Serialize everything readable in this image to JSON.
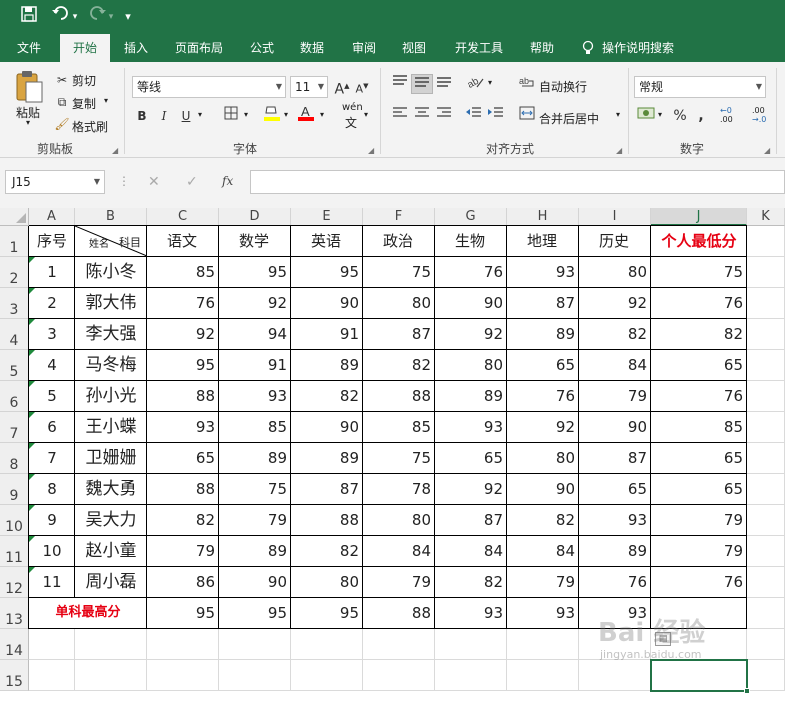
{
  "quick_access": {
    "save": "save-icon",
    "undo": "undo-icon",
    "redo": "redo-icon",
    "customize": "▾"
  },
  "menu": {
    "tabs": [
      "文件",
      "开始",
      "插入",
      "页面布局",
      "公式",
      "数据",
      "审阅",
      "视图",
      "开发工具",
      "帮助"
    ],
    "active": "开始",
    "tell_me": "操作说明搜索"
  },
  "ribbon": {
    "clipboard": {
      "paste": "粘贴",
      "cut": "剪切",
      "copy": "复制",
      "format_painter": "格式刷",
      "label": "剪贴板"
    },
    "font": {
      "name": "等线",
      "size": "11",
      "label": "字体",
      "grow": "A",
      "shrink": "A",
      "bold": "B",
      "italic": "I",
      "underline": "U",
      "wen": "wén"
    },
    "alignment": {
      "wrap": "自动换行",
      "merge": "合并后居中",
      "label": "对齐方式"
    },
    "number": {
      "format": "常规",
      "percent": "%",
      "comma": ",",
      "inc": ".00",
      "label": "数字"
    }
  },
  "formula_bar": {
    "name_box": "J15",
    "cancel": "✕",
    "enter": "✓",
    "fx": "fx",
    "value": ""
  },
  "columns": [
    "A",
    "B",
    "C",
    "D",
    "E",
    "F",
    "G",
    "H",
    "I",
    "J",
    "K"
  ],
  "rows": [
    "1",
    "2",
    "3",
    "4",
    "5",
    "6",
    "7",
    "8",
    "9",
    "10",
    "11",
    "12",
    "13",
    "14",
    "15"
  ],
  "selected_column": "J",
  "table": {
    "header": {
      "index": "序号",
      "name_diag_bottom": "姓名",
      "name_diag_top": "科目",
      "subjects": [
        "语文",
        "数学",
        "英语",
        "政治",
        "生物",
        "地理",
        "历史"
      ],
      "min_col": "个人最低分"
    },
    "students": [
      {
        "idx": "1",
        "name": "陈小冬",
        "scores": [
          "85",
          "95",
          "95",
          "75",
          "76",
          "93",
          "80"
        ],
        "min": "75"
      },
      {
        "idx": "2",
        "name": "郭大伟",
        "scores": [
          "76",
          "92",
          "90",
          "80",
          "90",
          "87",
          "92"
        ],
        "min": "76"
      },
      {
        "idx": "3",
        "name": "李大强",
        "scores": [
          "92",
          "94",
          "91",
          "87",
          "92",
          "89",
          "82"
        ],
        "min": "82"
      },
      {
        "idx": "4",
        "name": "马冬梅",
        "scores": [
          "95",
          "91",
          "89",
          "82",
          "80",
          "65",
          "84"
        ],
        "min": "65"
      },
      {
        "idx": "5",
        "name": "孙小光",
        "scores": [
          "88",
          "93",
          "82",
          "88",
          "89",
          "76",
          "79"
        ],
        "min": "76"
      },
      {
        "idx": "6",
        "name": "王小蝶",
        "scores": [
          "93",
          "85",
          "90",
          "85",
          "93",
          "92",
          "90"
        ],
        "min": "85"
      },
      {
        "idx": "7",
        "name": "卫姗姗",
        "scores": [
          "65",
          "89",
          "89",
          "75",
          "65",
          "80",
          "87"
        ],
        "min": "65"
      },
      {
        "idx": "8",
        "name": "魏大勇",
        "scores": [
          "88",
          "75",
          "87",
          "78",
          "92",
          "90",
          "65"
        ],
        "min": "65"
      },
      {
        "idx": "9",
        "name": "吴大力",
        "scores": [
          "82",
          "79",
          "88",
          "80",
          "87",
          "82",
          "93"
        ],
        "min": "79"
      },
      {
        "idx": "10",
        "name": "赵小童",
        "scores": [
          "79",
          "89",
          "82",
          "84",
          "84",
          "84",
          "89"
        ],
        "min": "79"
      },
      {
        "idx": "11",
        "name": "周小磊",
        "scores": [
          "86",
          "90",
          "80",
          "79",
          "82",
          "79",
          "76"
        ],
        "min": "76"
      }
    ],
    "max_row": {
      "label": "单科最高分",
      "values": [
        "95",
        "95",
        "95",
        "88",
        "93",
        "93",
        "93"
      ]
    }
  },
  "watermark": {
    "text": "Bai 经验",
    "sub": "jingyan.baidu.com"
  }
}
